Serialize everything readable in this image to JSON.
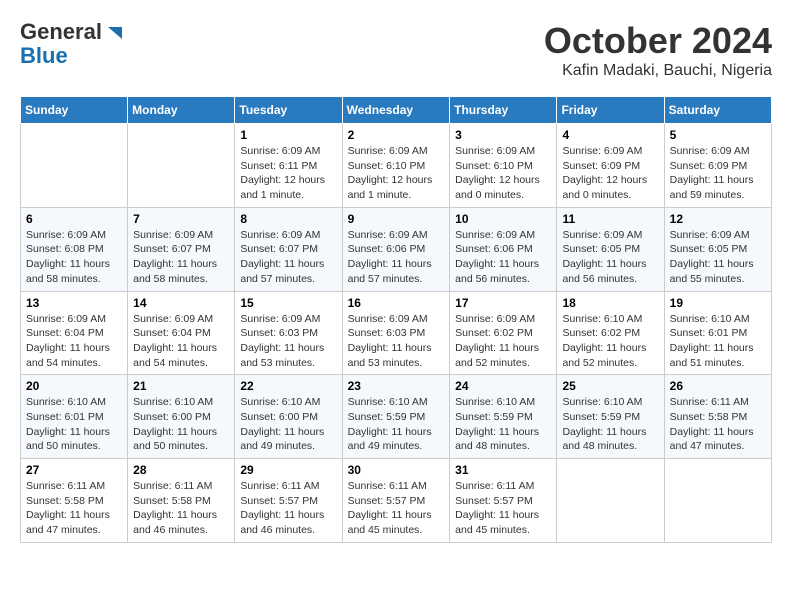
{
  "header": {
    "logo_general": "General",
    "logo_blue": "Blue",
    "month_year": "October 2024",
    "location": "Kafin Madaki, Bauchi, Nigeria"
  },
  "weekdays": [
    "Sunday",
    "Monday",
    "Tuesday",
    "Wednesday",
    "Thursday",
    "Friday",
    "Saturday"
  ],
  "weeks": [
    [
      {
        "day": "",
        "info": ""
      },
      {
        "day": "",
        "info": ""
      },
      {
        "day": "1",
        "info": "Sunrise: 6:09 AM\nSunset: 6:11 PM\nDaylight: 12 hours\nand 1 minute."
      },
      {
        "day": "2",
        "info": "Sunrise: 6:09 AM\nSunset: 6:10 PM\nDaylight: 12 hours\nand 1 minute."
      },
      {
        "day": "3",
        "info": "Sunrise: 6:09 AM\nSunset: 6:10 PM\nDaylight: 12 hours\nand 0 minutes."
      },
      {
        "day": "4",
        "info": "Sunrise: 6:09 AM\nSunset: 6:09 PM\nDaylight: 12 hours\nand 0 minutes."
      },
      {
        "day": "5",
        "info": "Sunrise: 6:09 AM\nSunset: 6:09 PM\nDaylight: 11 hours\nand 59 minutes."
      }
    ],
    [
      {
        "day": "6",
        "info": "Sunrise: 6:09 AM\nSunset: 6:08 PM\nDaylight: 11 hours\nand 58 minutes."
      },
      {
        "day": "7",
        "info": "Sunrise: 6:09 AM\nSunset: 6:07 PM\nDaylight: 11 hours\nand 58 minutes."
      },
      {
        "day": "8",
        "info": "Sunrise: 6:09 AM\nSunset: 6:07 PM\nDaylight: 11 hours\nand 57 minutes."
      },
      {
        "day": "9",
        "info": "Sunrise: 6:09 AM\nSunset: 6:06 PM\nDaylight: 11 hours\nand 57 minutes."
      },
      {
        "day": "10",
        "info": "Sunrise: 6:09 AM\nSunset: 6:06 PM\nDaylight: 11 hours\nand 56 minutes."
      },
      {
        "day": "11",
        "info": "Sunrise: 6:09 AM\nSunset: 6:05 PM\nDaylight: 11 hours\nand 56 minutes."
      },
      {
        "day": "12",
        "info": "Sunrise: 6:09 AM\nSunset: 6:05 PM\nDaylight: 11 hours\nand 55 minutes."
      }
    ],
    [
      {
        "day": "13",
        "info": "Sunrise: 6:09 AM\nSunset: 6:04 PM\nDaylight: 11 hours\nand 54 minutes."
      },
      {
        "day": "14",
        "info": "Sunrise: 6:09 AM\nSunset: 6:04 PM\nDaylight: 11 hours\nand 54 minutes."
      },
      {
        "day": "15",
        "info": "Sunrise: 6:09 AM\nSunset: 6:03 PM\nDaylight: 11 hours\nand 53 minutes."
      },
      {
        "day": "16",
        "info": "Sunrise: 6:09 AM\nSunset: 6:03 PM\nDaylight: 11 hours\nand 53 minutes."
      },
      {
        "day": "17",
        "info": "Sunrise: 6:09 AM\nSunset: 6:02 PM\nDaylight: 11 hours\nand 52 minutes."
      },
      {
        "day": "18",
        "info": "Sunrise: 6:10 AM\nSunset: 6:02 PM\nDaylight: 11 hours\nand 52 minutes."
      },
      {
        "day": "19",
        "info": "Sunrise: 6:10 AM\nSunset: 6:01 PM\nDaylight: 11 hours\nand 51 minutes."
      }
    ],
    [
      {
        "day": "20",
        "info": "Sunrise: 6:10 AM\nSunset: 6:01 PM\nDaylight: 11 hours\nand 50 minutes."
      },
      {
        "day": "21",
        "info": "Sunrise: 6:10 AM\nSunset: 6:00 PM\nDaylight: 11 hours\nand 50 minutes."
      },
      {
        "day": "22",
        "info": "Sunrise: 6:10 AM\nSunset: 6:00 PM\nDaylight: 11 hours\nand 49 minutes."
      },
      {
        "day": "23",
        "info": "Sunrise: 6:10 AM\nSunset: 5:59 PM\nDaylight: 11 hours\nand 49 minutes."
      },
      {
        "day": "24",
        "info": "Sunrise: 6:10 AM\nSunset: 5:59 PM\nDaylight: 11 hours\nand 48 minutes."
      },
      {
        "day": "25",
        "info": "Sunrise: 6:10 AM\nSunset: 5:59 PM\nDaylight: 11 hours\nand 48 minutes."
      },
      {
        "day": "26",
        "info": "Sunrise: 6:11 AM\nSunset: 5:58 PM\nDaylight: 11 hours\nand 47 minutes."
      }
    ],
    [
      {
        "day": "27",
        "info": "Sunrise: 6:11 AM\nSunset: 5:58 PM\nDaylight: 11 hours\nand 47 minutes."
      },
      {
        "day": "28",
        "info": "Sunrise: 6:11 AM\nSunset: 5:58 PM\nDaylight: 11 hours\nand 46 minutes."
      },
      {
        "day": "29",
        "info": "Sunrise: 6:11 AM\nSunset: 5:57 PM\nDaylight: 11 hours\nand 46 minutes."
      },
      {
        "day": "30",
        "info": "Sunrise: 6:11 AM\nSunset: 5:57 PM\nDaylight: 11 hours\nand 45 minutes."
      },
      {
        "day": "31",
        "info": "Sunrise: 6:11 AM\nSunset: 5:57 PM\nDaylight: 11 hours\nand 45 minutes."
      },
      {
        "day": "",
        "info": ""
      },
      {
        "day": "",
        "info": ""
      }
    ]
  ]
}
